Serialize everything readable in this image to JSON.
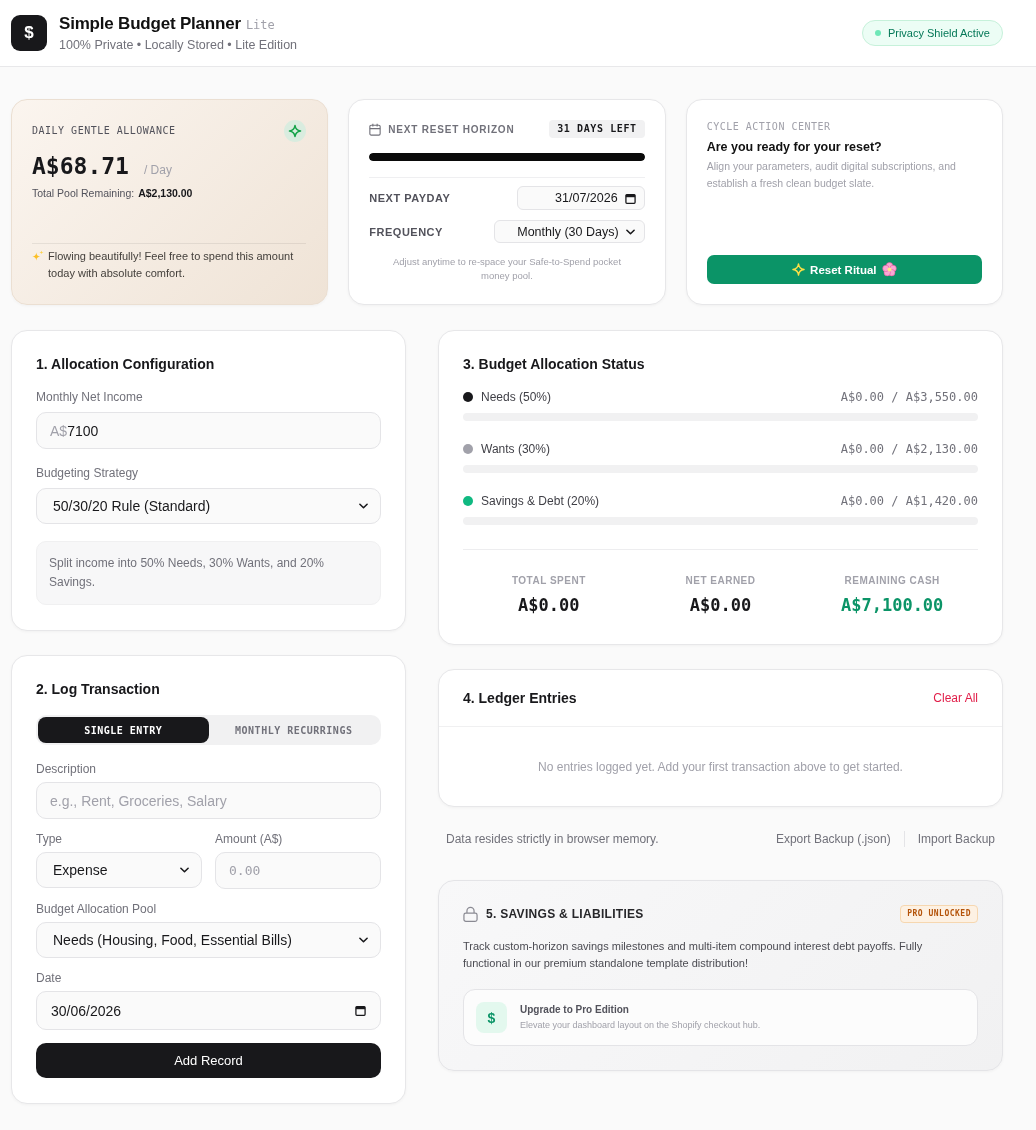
{
  "header": {
    "logo": "$",
    "title": "Simple Budget Planner",
    "edition": "Lite",
    "subtitle": "100% Private • Locally Stored • Lite Edition",
    "status_badge": "Privacy Shield Active"
  },
  "allowance_card": {
    "label": "DAILY GENTLE ALLOWANCE",
    "amount": "A$68.71",
    "unit": "/ Day",
    "pool_label": "Total Pool Remaining:",
    "pool_value": "A$2,130.00",
    "message": "Flowing beautifully! Feel free to spend this amount today with absolute comfort."
  },
  "reset_card": {
    "label": "NEXT RESET HORIZON",
    "days_left": "31 DAYS LEFT",
    "progress": {
      "level": 1
    },
    "fields": [
      {
        "label": "NEXT PAYDAY",
        "kind": "date",
        "value": "31/07/2026"
      },
      {
        "label": "FREQUENCY",
        "kind": "select",
        "value": "Monthly (30 Days)"
      }
    ],
    "hint": "Adjust anytime to re-space your Safe-to-Spend pocket money pool."
  },
  "action_card": {
    "label": "CYCLE ACTION CENTER",
    "heading": "Are you ready for your reset?",
    "description": "Align your parameters, audit digital subscriptions, and establish a fresh clean budget slate.",
    "button": "Reset Ritual"
  },
  "allocation": {
    "title": "1. Allocation Configuration",
    "fields": [
      {
        "label": "Monthly Net Income",
        "kind": "currency",
        "prefix": "A$",
        "value": "7100"
      },
      {
        "label": "Budgeting Strategy",
        "kind": "select",
        "value": "50/30/20 Rule (Standard)"
      }
    ],
    "note": "Split income into 50% Needs, 30% Wants, and 20% Savings."
  },
  "log": {
    "title": "2. Log Transaction",
    "tabs": [
      {
        "label": "SINGLE ENTRY",
        "selected": true
      },
      {
        "label": "MONTHLY RECURRINGS",
        "selected": false
      }
    ],
    "field_rows": [
      [
        {
          "label": "Description",
          "kind": "text",
          "placeholder": "e.g., Rent, Groceries, Salary"
        }
      ],
      [
        {
          "label": "Type",
          "kind": "select",
          "value": "Expense"
        },
        {
          "label": "Amount (A$)",
          "kind": "number",
          "placeholder": "0.00"
        }
      ],
      [
        {
          "label": "Budget Allocation Pool",
          "kind": "select",
          "value": "Needs (Housing, Food, Essential Bills)"
        }
      ],
      [
        {
          "label": "Date",
          "kind": "date",
          "value": "30/06/2026"
        }
      ]
    ],
    "button": "Add Record"
  },
  "budget_status": {
    "title": "3. Budget Allocation Status",
    "categories": [
      {
        "name": "Needs (50%)",
        "color": "#18181b",
        "amount": "A$0.00 / A$3,550.00",
        "level": 0
      },
      {
        "name": "Wants (30%)",
        "color": "#a1a1aa",
        "amount": "A$0.00 / A$2,130.00",
        "level": 0
      },
      {
        "name": "Savings & Debt (20%)",
        "color": "#10b981",
        "amount": "A$0.00 / A$1,420.00",
        "level": 0
      }
    ],
    "totals": [
      {
        "label": "TOTAL SPENT",
        "value": "A$0.00",
        "kind": "neutral"
      },
      {
        "label": "NET EARNED",
        "value": "A$0.00",
        "kind": "neutral"
      },
      {
        "label": "REMAINING CASH",
        "value": "A$7,100.00",
        "kind": "positive"
      }
    ]
  },
  "ledger": {
    "title": "4. Ledger Entries",
    "action": "Clear All",
    "empty_message": "No entries logged yet. Add your first transaction above to get started."
  },
  "storage_footer": {
    "note": "Data resides strictly in browser memory.",
    "links": [
      "Export Backup (.json)",
      "Import Backup"
    ]
  },
  "savings": {
    "title": "5. SAVINGS & LIABILITIES",
    "badge": "PRO UNLOCKED",
    "description": "Track custom-horizon savings milestones and multi-item compound interest debt payoffs. Fully functional in our premium standalone template distribution!",
    "upgrade": {
      "icon": "$",
      "title": "Upgrade to Pro Edition",
      "subtitle": "Elevate your dashboard layout on the Shopify checkout hub."
    }
  }
}
